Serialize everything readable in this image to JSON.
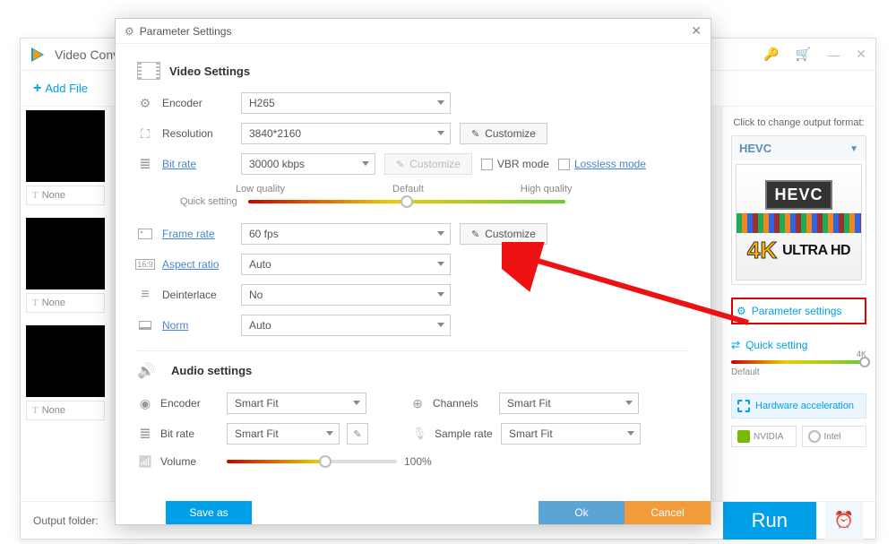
{
  "mainWindow": {
    "title": "Video Conv",
    "addFile": "Add File",
    "thumbs": [
      "None",
      "None",
      "None"
    ],
    "outputFolder": "Output folder:",
    "run": "Run"
  },
  "rightPanel": {
    "changeFormat": "Click to change output format:",
    "format": "HEVC",
    "hevcBadge": "HEVC",
    "fourK": "4K",
    "ultraHd": "ULTRA HD",
    "paramSettings": "Parameter settings",
    "quickSetting": "Quick setting",
    "fourKLabel": "4K",
    "defaultLabel": "Default",
    "hwAccel": "Hardware acceleration",
    "nvidia": "NVIDIA",
    "intel": "Intel"
  },
  "dialog": {
    "title": "Parameter Settings",
    "video": {
      "heading": "Video Settings",
      "encoder": {
        "label": "Encoder",
        "value": "H265"
      },
      "resolution": {
        "label": "Resolution",
        "value": "3840*2160",
        "customize": "Customize"
      },
      "bitrate": {
        "label": "Bit rate",
        "value": "30000 kbps",
        "customize": "Customize",
        "vbr": "VBR mode",
        "lossless": "Lossless mode"
      },
      "quality": {
        "sub": "Quick setting",
        "low": "Low quality",
        "default": "Default",
        "high": "High quality"
      },
      "framerate": {
        "label": "Frame rate",
        "value": "60 fps",
        "customize": "Customize"
      },
      "aspect": {
        "label": "Aspect ratio",
        "value": "Auto"
      },
      "deinterlace": {
        "label": "Deinterlace",
        "value": "No"
      },
      "norm": {
        "label": "Norm",
        "value": "Auto"
      }
    },
    "audio": {
      "heading": "Audio settings",
      "encoder": {
        "label": "Encoder",
        "value": "Smart Fit"
      },
      "channels": {
        "label": "Channels",
        "value": "Smart Fit"
      },
      "bitrate": {
        "label": "Bit rate",
        "value": "Smart Fit"
      },
      "samplerate": {
        "label": "Sample rate",
        "value": "Smart Fit"
      },
      "volume": {
        "label": "Volume",
        "percent": "100%"
      }
    },
    "footer": {
      "save": "Save as",
      "ok": "Ok",
      "cancel": "Cancel"
    }
  }
}
